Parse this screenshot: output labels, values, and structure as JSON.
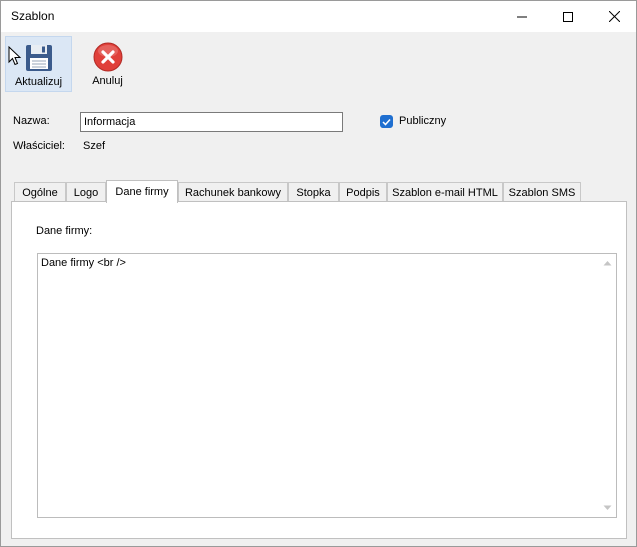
{
  "window": {
    "title": "Szablon",
    "controls": [
      "minimize-icon",
      "maximize-icon",
      "close-icon"
    ]
  },
  "toolbar": {
    "update_label": "Aktualizuj",
    "cancel_label": "Anuluj",
    "update_icon": "floppy-disk-icon",
    "cancel_icon": "red-x-circle-icon"
  },
  "form": {
    "name_label": "Nazwa:",
    "name_value": "Informacja",
    "public_label": "Publiczny",
    "public_checked": true,
    "owner_label": "Właściciel:",
    "owner_value": "Szef"
  },
  "tabs": [
    {
      "label": "Ogólne",
      "active": false
    },
    {
      "label": "Logo",
      "active": false
    },
    {
      "label": "Dane firmy",
      "active": true
    },
    {
      "label": "Rachunek bankowy",
      "active": false
    },
    {
      "label": "Stopka",
      "active": false
    },
    {
      "label": "Podpis",
      "active": false
    },
    {
      "label": "Szablon e-mail HTML",
      "active": false
    },
    {
      "label": "Szablon SMS",
      "active": false
    }
  ],
  "panel": {
    "field_label": "Dane firmy:",
    "field_value": "Dane firmy <br />"
  },
  "colors": {
    "accent": "#1f6fd0",
    "cancel_red": "#e0403a",
    "window_bg": "#f0f0f0"
  }
}
